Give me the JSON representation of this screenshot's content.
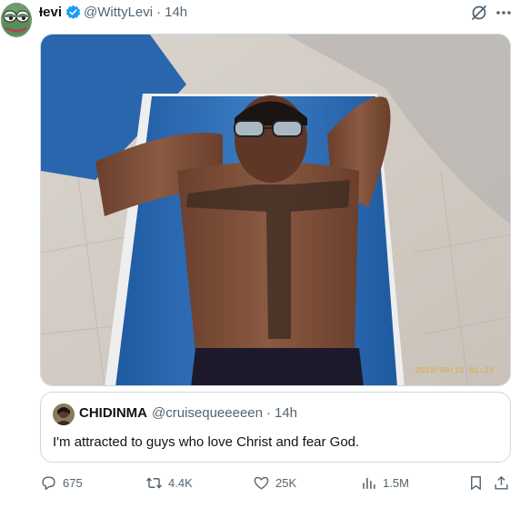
{
  "tweet": {
    "author_name": "Ɨevi",
    "author_handle": "@WittyLevi",
    "separator": "·",
    "time": "14h",
    "verified": true,
    "media_watermark": "2019/09/10 01:23",
    "avatar_icon": "frog-avatar",
    "header_icons": [
      "grok-icon",
      "more-icon"
    ]
  },
  "quote": {
    "author_name": "CHIDINMA",
    "author_handle": "@cruisequeeeeen",
    "separator": "·",
    "time": "14h",
    "text": "I'm attracted to guys who love Christ and fear God."
  },
  "actions": {
    "reply_count": "675",
    "repost_count": "4.4K",
    "like_count": "25K",
    "view_count": "1.5M",
    "icons": [
      "reply-icon",
      "repost-icon",
      "like-icon",
      "views-icon",
      "bookmark-icon",
      "share-icon"
    ]
  },
  "colors": {
    "text": "#0f1419",
    "secondary": "#536471",
    "verified": "#1d9bf0",
    "border": "#cfd9de",
    "mattress": "#2f6fb6"
  }
}
